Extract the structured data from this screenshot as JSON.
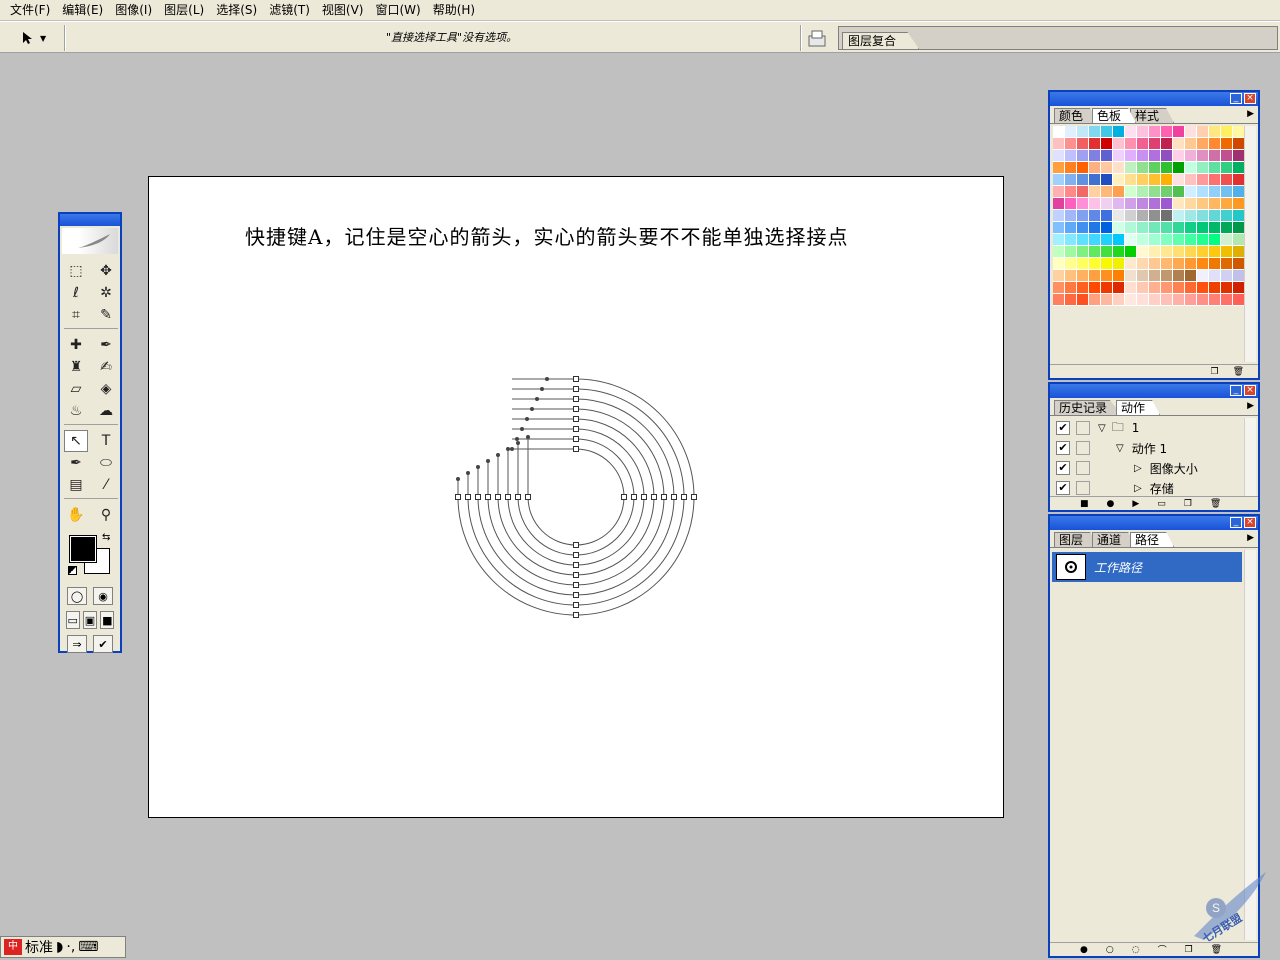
{
  "menu": [
    "文件(F)",
    "编辑(E)",
    "图像(I)",
    "图层(L)",
    "选择(S)",
    "滤镜(T)",
    "视图(V)",
    "窗口(W)",
    "帮助(H)"
  ],
  "options_bar": {
    "tool_icon": "direct-select-arrow-icon",
    "message": "\"直接选择工具\"没有选项。",
    "well_tab": "图层复合"
  },
  "document": {
    "caption": "快捷键A，记住是空心的箭头，实心的箭头要不不能单独选择接点"
  },
  "toolbox": {
    "tools": [
      [
        "marquee-icon",
        "⬚"
      ],
      [
        "move-icon",
        "✥"
      ],
      [
        "lasso-icon",
        "ℓ"
      ],
      [
        "magic-wand-icon",
        "✲"
      ],
      [
        "crop-icon",
        "⌗"
      ],
      [
        "slice-icon",
        "✎"
      ],
      [
        "healing-brush-icon",
        "✚"
      ],
      [
        "brush-icon",
        "✒"
      ],
      [
        "clone-stamp-icon",
        "♜"
      ],
      [
        "history-brush-icon",
        "✍"
      ],
      [
        "eraser-icon",
        "▱"
      ],
      [
        "paint-bucket-icon",
        "◈"
      ],
      [
        "blur-icon",
        "♨"
      ],
      [
        "dodge-icon",
        "☁"
      ],
      [
        "direct-select-icon",
        "↖"
      ],
      [
        "type-icon",
        "T"
      ],
      [
        "pen-icon",
        "✒"
      ],
      [
        "shape-icon",
        "⬭"
      ],
      [
        "notes-icon",
        "▤"
      ],
      [
        "eyedropper-icon",
        "⁄"
      ],
      [
        "hand-icon",
        "✋"
      ],
      [
        "zoom-icon",
        "⚲"
      ]
    ]
  },
  "swatches_panel": {
    "tabs": [
      "颜色",
      "色板",
      "样式"
    ],
    "active_tab": "色板",
    "colors": [
      "#ffffff",
      "#e0f0ff",
      "#c0e8f8",
      "#80d8f0",
      "#40c8e8",
      "#00b0e0",
      "#ffe0f0",
      "#ffc0e0",
      "#ff90c8",
      "#ff60b0",
      "#f040a0",
      "#ffe0e0",
      "#ffd0b0",
      "#ffe880",
      "#fff060",
      "#fff8a0",
      "#ffc0c0",
      "#ff9090",
      "#f06060",
      "#e03030",
      "#d00000",
      "#ffc0d0",
      "#ff90b0",
      "#f06090",
      "#e04070",
      "#c02050",
      "#ffe0c0",
      "#ffc890",
      "#ffa860",
      "#ff8830",
      "#f06800",
      "#d04800",
      "#e0e0ff",
      "#c0c0ff",
      "#a0a0f0",
      "#8080e0",
      "#6060d0",
      "#f0d0ff",
      "#e0b0ff",
      "#c890f0",
      "#b070e0",
      "#9050c0",
      "#ffd0e8",
      "#f0b0d8",
      "#e090c0",
      "#d070a8",
      "#c05090",
      "#a03070",
      "#ffa040",
      "#ff8020",
      "#ff6000",
      "#ffb080",
      "#ffc8a0",
      "#ffe0c8",
      "#c0f0c0",
      "#90e090",
      "#60d060",
      "#30c030",
      "#00a000",
      "#c0ffe0",
      "#90f0c0",
      "#60e0a0",
      "#30d080",
      "#00b060",
      "#a0d0ff",
      "#80b0f0",
      "#6090e0",
      "#4070d0",
      "#2050c0",
      "#fff0c0",
      "#ffe090",
      "#ffd060",
      "#ffc030",
      "#ffb000",
      "#ffe0e0",
      "#ffc0c0",
      "#ff9898",
      "#ff7070",
      "#f05050",
      "#e03030",
      "#ffb0b0",
      "#ff8888",
      "#f06868",
      "#ffd0a0",
      "#ffb878",
      "#ffa050",
      "#d0ffd0",
      "#b0f0b0",
      "#90e090",
      "#70d070",
      "#50c050",
      "#d0f0ff",
      "#b0e0ff",
      "#90d0f8",
      "#70c0f0",
      "#50b0e8",
      "#e040a0",
      "#ff60c0",
      "#ff90d8",
      "#ffc0e8",
      "#f0d0f0",
      "#e0b8f0",
      "#d0a0e8",
      "#c088e0",
      "#b070d8",
      "#a058d0",
      "#ffe8c0",
      "#ffd8a0",
      "#ffc880",
      "#ffb860",
      "#ffa840",
      "#ff9820",
      "#c0d0ff",
      "#a0b8f8",
      "#80a0f0",
      "#6088e8",
      "#4070e0",
      "#e8e8e8",
      "#d0d0d0",
      "#b0b0b0",
      "#909090",
      "#707070",
      "#c0f0f0",
      "#a0e8e8",
      "#80e0e0",
      "#60d8d8",
      "#40d0d0",
      "#20c8c8",
      "#80c0ff",
      "#60a8f8",
      "#4090f0",
      "#2078e8",
      "#0060e0",
      "#d0ffe8",
      "#b0f8d8",
      "#90f0c8",
      "#70e8b8",
      "#50e0a8",
      "#30d898",
      "#10d088",
      "#00c878",
      "#00b868",
      "#00a858",
      "#009848",
      "#a0f0ff",
      "#80e8ff",
      "#60e0ff",
      "#40d8ff",
      "#20d0ff",
      "#00c8ff",
      "#e0fff0",
      "#c0ffe0",
      "#a0ffd0",
      "#80ffc0",
      "#60ffb0",
      "#40ffa0",
      "#20ff90",
      "#00ff80",
      "#d0f0d0",
      "#b0e8b0",
      "#c0ffc0",
      "#a0f8a0",
      "#80f080",
      "#60e860",
      "#40e040",
      "#20d820",
      "#00d000",
      "#fff8d0",
      "#fff0b0",
      "#ffe890",
      "#ffe070",
      "#ffd850",
      "#ffd030",
      "#ffc810",
      "#f0c000",
      "#e0b000",
      "#ffffc0",
      "#ffff90",
      "#ffff60",
      "#ffff30",
      "#f8f800",
      "#f0f000",
      "#ffe8d0",
      "#ffd8b0",
      "#ffc890",
      "#ffb870",
      "#ffa850",
      "#ff9830",
      "#ff8810",
      "#f07800",
      "#e06800",
      "#d05800",
      "#ffd0a0",
      "#ffc080",
      "#ffb060",
      "#ffa040",
      "#ff9020",
      "#ff8000",
      "#f0e0d0",
      "#e0c8b0",
      "#d0b090",
      "#c09870",
      "#b08050",
      "#a06830",
      "#f0f0ff",
      "#e0e0f8",
      "#d0d0f0",
      "#c0c0e8",
      "#ff9060",
      "#ff7840",
      "#ff6020",
      "#ff4800",
      "#f03800",
      "#e02800",
      "#ffe0d0",
      "#ffc8b0",
      "#ffb090",
      "#ff9870",
      "#ff8050",
      "#ff6830",
      "#ff5010",
      "#f04000",
      "#e03000",
      "#d02000",
      "#ff8060",
      "#ff6840",
      "#ff5020",
      "#ffa080",
      "#ffb8a0",
      "#ffd0c0",
      "#ffe8e0",
      "#ffe0d8",
      "#ffd0c8",
      "#ffc0b8",
      "#ffb0a8",
      "#ffa098",
      "#ff9088",
      "#ff8078",
      "#ff7068",
      "#ff6058"
    ]
  },
  "history_panel": {
    "tabs": [
      "历史记录",
      "动作"
    ],
    "active_tab": "动作",
    "rows": [
      {
        "label": "1",
        "indent": 0
      },
      {
        "label": "动作 1",
        "indent": 1
      },
      {
        "label": "图像大小",
        "indent": 2
      },
      {
        "label": "存储",
        "indent": 2
      }
    ]
  },
  "layers_panel": {
    "tabs": [
      "图层",
      "通道",
      "路径"
    ],
    "active_tab": "路径",
    "path_name": "工作路径"
  },
  "ime": {
    "label": "标准"
  },
  "watermark": "七月联盟"
}
